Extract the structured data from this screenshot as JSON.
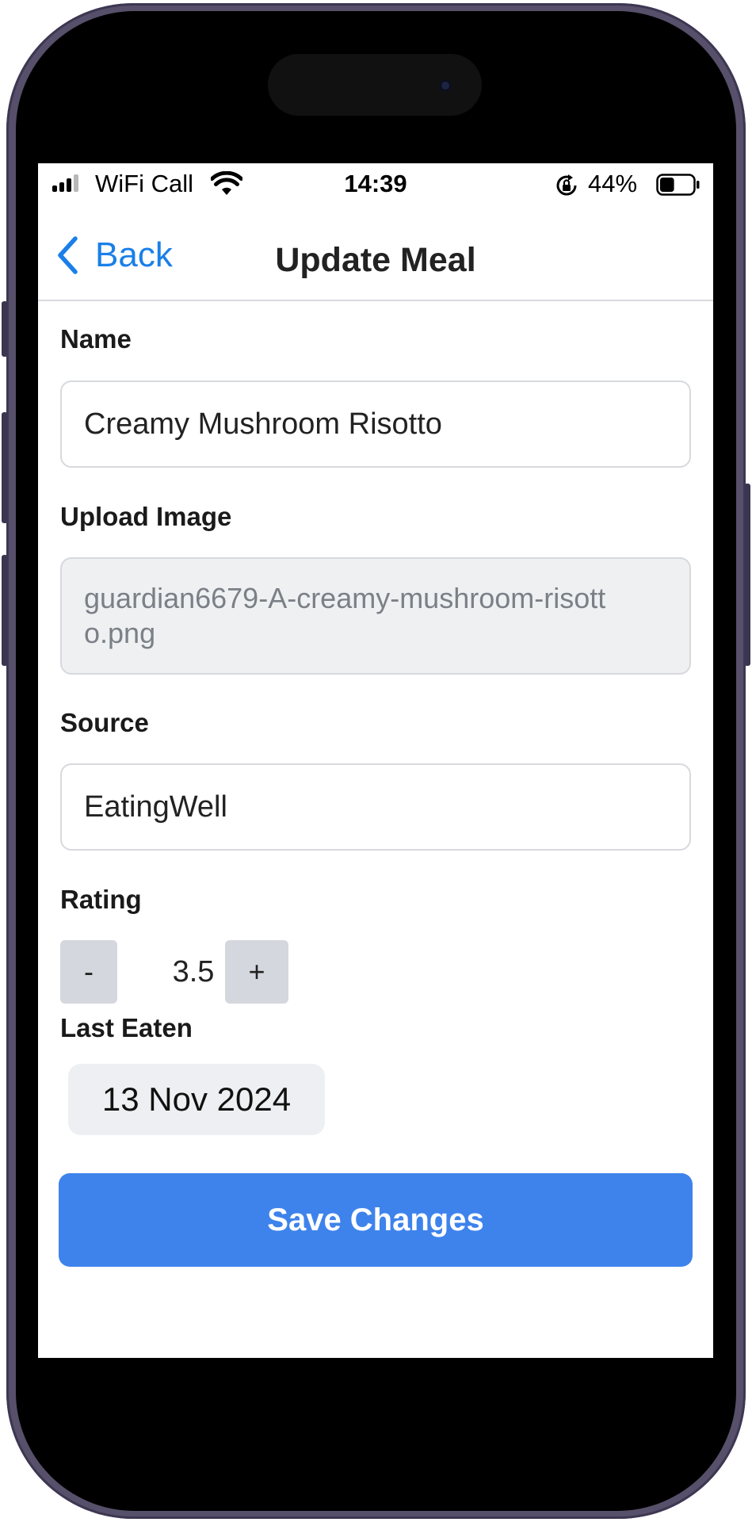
{
  "status_bar": {
    "carrier": "WiFi Call",
    "time": "14:39",
    "battery_percent": "44%",
    "battery_level": 0.44,
    "icons": [
      "signal-icon",
      "wifi-icon",
      "orientation-lock-icon",
      "battery-icon"
    ]
  },
  "nav": {
    "back_label": "Back",
    "title": "Update Meal"
  },
  "form": {
    "name": {
      "label": "Name",
      "value": "Creamy Mushroom Risotto"
    },
    "image": {
      "label": "Upload Image",
      "value": "guardian6679-A-creamy-mushroom-risotto.png"
    },
    "source": {
      "label": "Source",
      "value": "EatingWell"
    },
    "rating": {
      "label": "Rating",
      "value": "3.5",
      "decrement": "-",
      "increment": "+"
    },
    "last_eaten": {
      "label": "Last Eaten",
      "value": "13 Nov 2024"
    },
    "submit_label": "Save Changes"
  },
  "colors": {
    "accent": "#1a7fe8",
    "primary_button": "#3e83ec",
    "frame": "#57506b"
  }
}
